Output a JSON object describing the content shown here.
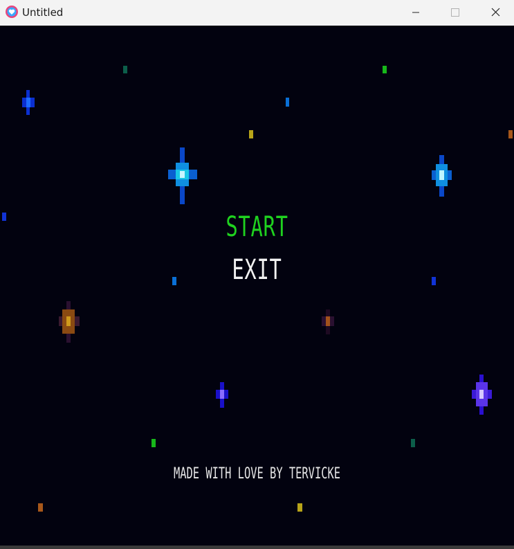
{
  "window": {
    "title": "Untitled",
    "controls": [
      "minimize",
      "maximize",
      "close"
    ]
  },
  "menu": {
    "start_label": "START",
    "exit_label": "EXIT"
  },
  "credit": "MADE WITH LOVE BY TERVICKE",
  "colors": {
    "background": "#02020f",
    "start_text": "#1fd21f",
    "exit_text": "#f2f2f2"
  }
}
